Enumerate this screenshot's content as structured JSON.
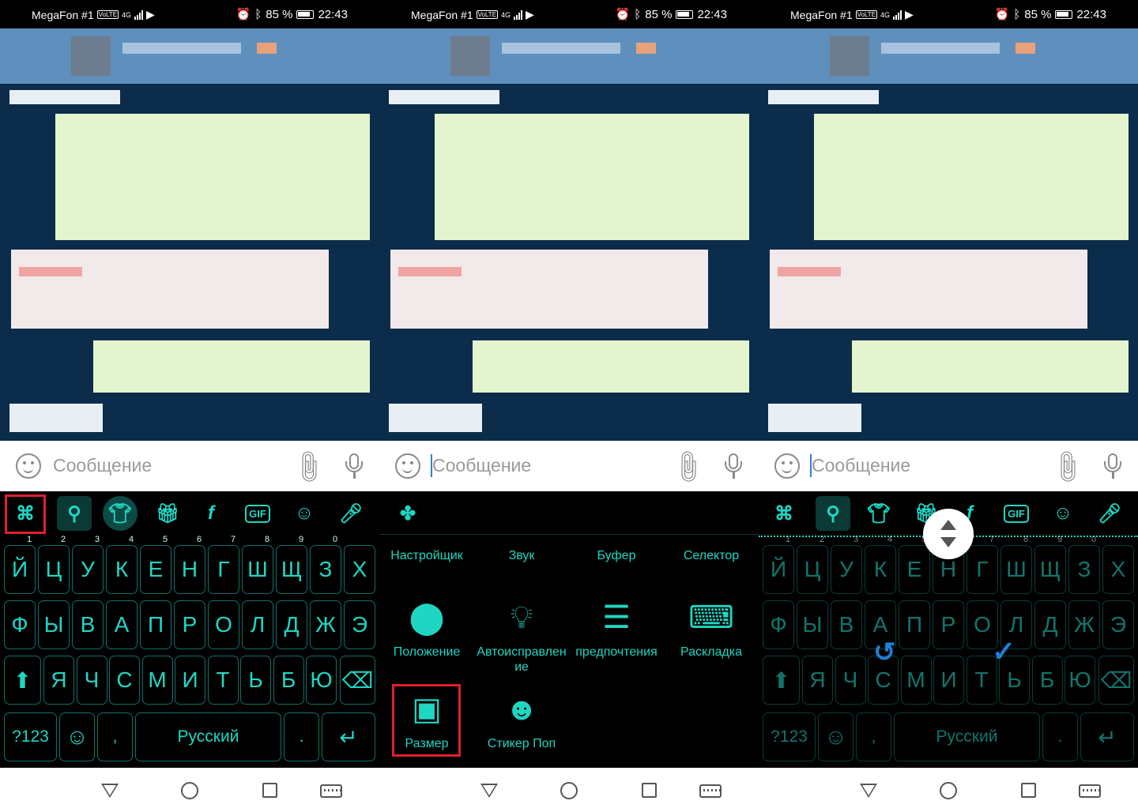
{
  "status": {
    "carrier": "MegaFon #1",
    "volte": "VoLTE",
    "network": "4G",
    "battery": "85 %",
    "time": "22:43"
  },
  "input": {
    "placeholder": "Сообщение"
  },
  "keyboard": {
    "rows": [
      [
        "Й",
        "Ц",
        "У",
        "К",
        "Е",
        "Н",
        "Г",
        "Ш",
        "Щ",
        "З",
        "Х"
      ],
      [
        "Ф",
        "Ы",
        "В",
        "А",
        "П",
        "Р",
        "О",
        "Л",
        "Д",
        "Ж",
        "Э"
      ],
      [
        "Я",
        "Ч",
        "С",
        "М",
        "И",
        "Т",
        "Ь",
        "Б",
        "Ю"
      ]
    ],
    "hints": [
      "1",
      "2",
      "3",
      "4",
      "5",
      "6",
      "7",
      "8",
      "9",
      "0"
    ],
    "symbols_label": "?123",
    "comma": ",",
    "space_label": "Русский",
    "period": ".",
    "toolbar_gif": "GIF",
    "accent_color": "#1fd6c3",
    "highlight_color": "#e0202a"
  },
  "menu": {
    "row1": [
      "Настройщик",
      "Звук",
      "Буфер",
      "Селектор"
    ],
    "row2": [
      "Положение",
      "Автоисправление",
      "предпочтения",
      "Раскладка"
    ],
    "row3": [
      "Размер",
      "Стикер Поп"
    ]
  },
  "icons": [
    "apps-icon",
    "search-icon",
    "theme-shirt-icon",
    "gift-icon",
    "font-icon",
    "gif-icon",
    "sticker-icon",
    "mic-icon",
    "resize-handle-icon",
    "undo-icon",
    "check-icon"
  ]
}
